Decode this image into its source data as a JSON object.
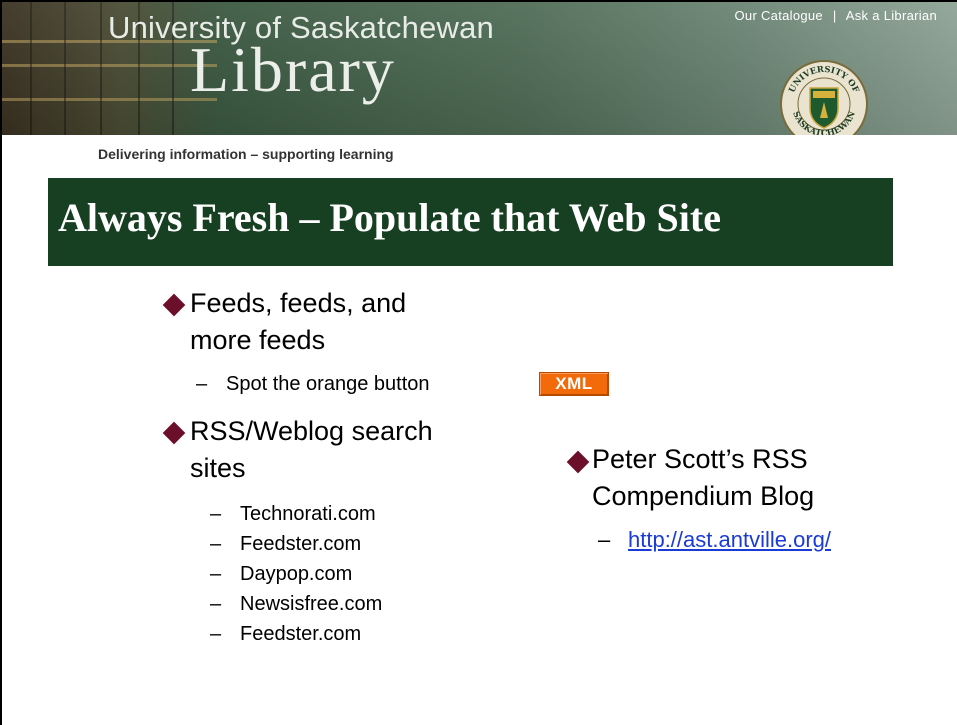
{
  "header": {
    "university": "University of Saskatchewan",
    "library": "Library",
    "links": [
      {
        "label": "Our Catalogue"
      },
      {
        "label": "Ask a Librarian"
      }
    ],
    "link_separator": "|",
    "seal_text": "UNIVERSITY OF SASKATCHEWAN",
    "tagline": "Delivering information – supporting learning"
  },
  "slide": {
    "title": "Always Fresh – Populate that Web Site",
    "bullets": [
      {
        "label_line1": "Feeds, feeds, and",
        "label_line2": "more feeds",
        "sub": [
          {
            "dash": "–",
            "text": "Spot the orange button"
          }
        ],
        "badge": "XML"
      },
      {
        "label_line1": "RSS/Weblog search",
        "label_line2": "sites",
        "sub": [
          {
            "dash": "–",
            "text": "Technorati.com"
          },
          {
            "dash": "–",
            "text": "Feedster.com"
          },
          {
            "dash": "–",
            "text": "Daypop.com"
          },
          {
            "dash": "–",
            "text": "Newsisfree.com"
          },
          {
            "dash": "–",
            "text": "Feedster.com"
          }
        ]
      },
      {
        "label_line1": "Peter Scott’s RSS",
        "label_line2": "Compendium Blog",
        "sub": [
          {
            "dash": "–",
            "text": "http://ast.antville.org/"
          }
        ]
      }
    ]
  },
  "colors": {
    "title_bar": "#173f21",
    "bullet_diamond": "#6b0f2b",
    "link": "#1b3bd6",
    "xml_badge": "#f26a0a"
  }
}
